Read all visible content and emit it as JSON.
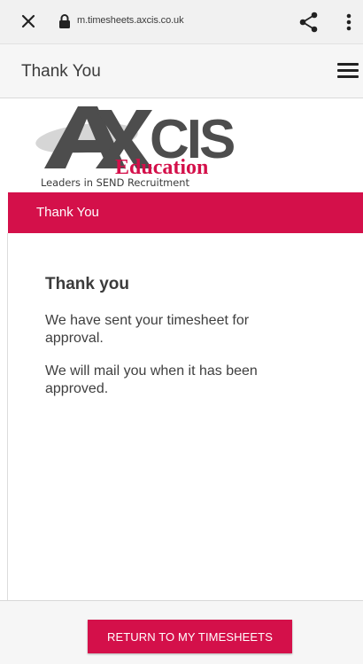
{
  "browser": {
    "url": "m.timesheets.axcis.co.uk",
    "icons": {
      "close": "close-icon",
      "lock": "lock-icon",
      "share": "share-icon",
      "more": "more-vertical-icon"
    }
  },
  "header": {
    "title": "Thank You",
    "menu_icon": "hamburger-menu-icon"
  },
  "logo": {
    "big_a": "A",
    "brand": "XCIS",
    "division": "Education",
    "tagline": "Leaders in SEND Recruitment"
  },
  "banner": {
    "text": "Thank You"
  },
  "content": {
    "heading": "Thank you",
    "paragraph1": "We have sent your timesheet for approval.",
    "paragraph2": "We will mail you when it has been approved."
  },
  "footer": {
    "return_button": "RETURN TO MY TIMESHEETS"
  },
  "colors": {
    "accent": "#d4104a",
    "logo_gray": "#4a4a4a"
  }
}
